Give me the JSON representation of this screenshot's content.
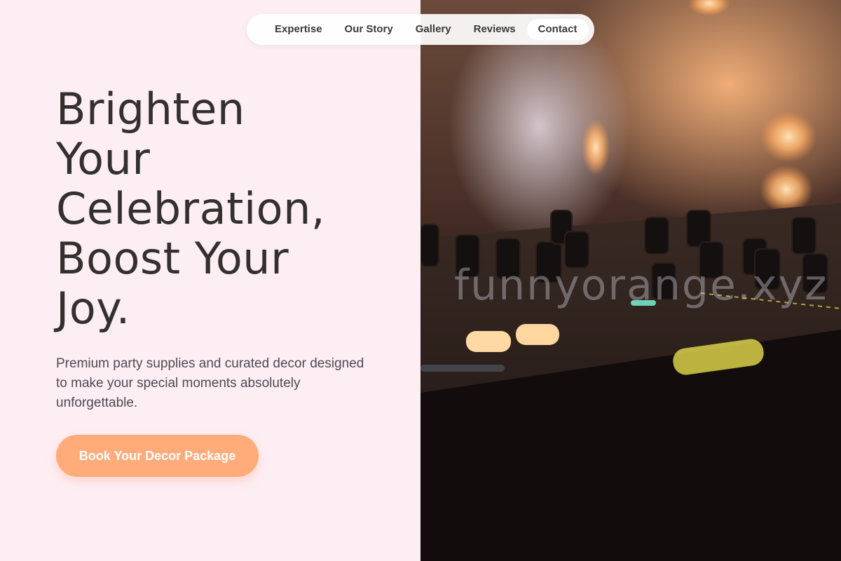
{
  "nav": {
    "items": [
      {
        "label": "Expertise"
      },
      {
        "label": "Our Story"
      },
      {
        "label": "Gallery"
      },
      {
        "label": "Reviews"
      },
      {
        "label": "Contact"
      }
    ]
  },
  "hero": {
    "title_lines": [
      "Brighten",
      "Your",
      "Celebration,",
      "Boost Your",
      "Joy."
    ],
    "subtitle": "Premium party supplies and curated decor designed to make your special moments absolutely unforgettable.",
    "cta_label": "Book Your Decor Package"
  },
  "image": {
    "subject": "DJ mixer console with warm bokeh lights",
    "watermark": "funnyorange.xyz"
  },
  "colors": {
    "background": "#fdeef3",
    "accent": "#ffab7a",
    "text_dark": "#333030",
    "text_muted": "#4e4a55"
  }
}
